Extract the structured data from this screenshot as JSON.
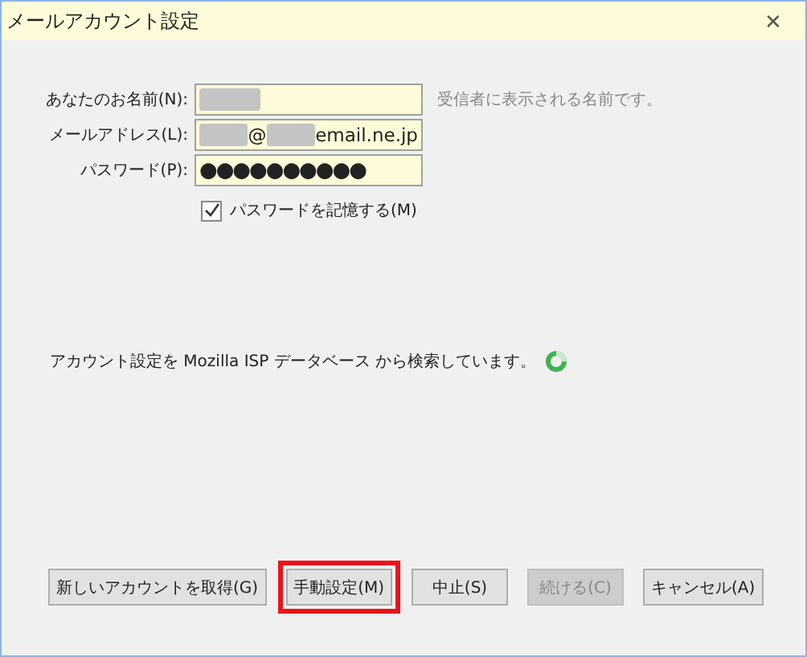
{
  "window": {
    "title": "メールアカウント設定",
    "close": "✕"
  },
  "fields": [
    {
      "label": "あなたのお名前(N):",
      "segments": [
        {
          "kind": "redacted"
        }
      ],
      "hint": "受信者に表示される名前です。"
    },
    {
      "label": "メールアドレス(L):",
      "segments": [
        {
          "kind": "redacted"
        },
        {
          "kind": "text",
          "text": "@"
        },
        {
          "kind": "redacted"
        },
        {
          "kind": "text",
          "text": "email.ne.jp"
        }
      ]
    },
    {
      "label": "パスワード(P):",
      "segments": [
        {
          "kind": "password",
          "text": "●●●●●●●●●●"
        }
      ]
    }
  ],
  "remember": {
    "label": "パスワードを記憶する(M)",
    "checked": true
  },
  "status": {
    "text": "アカウント設定を Mozilla ISP データベース から検索しています。",
    "busy": true
  },
  "buttons": [
    {
      "label": "新しいアカウントを取得(G)",
      "disabled": false,
      "highlighted": false
    },
    {
      "label": "手動設定(M)",
      "disabled": false,
      "highlighted": true
    },
    {
      "label": "中止(S)",
      "disabled": false,
      "highlighted": false
    },
    {
      "label": "続ける(C)",
      "disabled": true,
      "highlighted": false
    },
    {
      "label": "キャンセル(A)",
      "disabled": false,
      "highlighted": false
    }
  ]
}
